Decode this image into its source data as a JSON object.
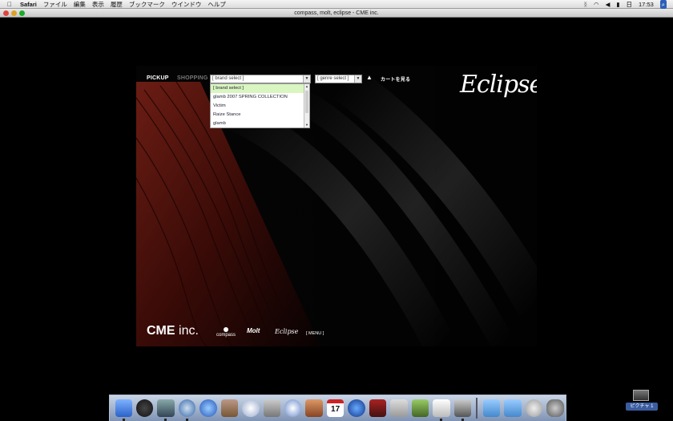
{
  "menubar": {
    "app": "Safari",
    "items": [
      "ファイル",
      "編集",
      "表示",
      "履歴",
      "ブックマーク",
      "ウインドウ",
      "ヘルプ"
    ],
    "status": {
      "input": "日",
      "clock": "17:53"
    }
  },
  "window": {
    "title": "compass, molt, eclipse - CME inc."
  },
  "site": {
    "nav_pickup": "PICKUP",
    "nav_shopping": "SHOPPING",
    "brand_select": "[ brand select ]",
    "genre_select": "[ genre select ]",
    "cart": "カートを見る",
    "brand_options": [
      "[ brand select ]",
      "glamb 2007 SPRING COLLECTION",
      "Victim",
      "Raize Stance",
      "glamb"
    ],
    "logo": "Eclipse",
    "company": "CME",
    "company_suffix": "inc.",
    "footer_compass": "compass",
    "footer_molt": "Molt",
    "footer_eclipse": "Eclipse",
    "footer_menu": "[ MENU ]"
  },
  "dock": {
    "apps": [
      "finder",
      "dashboard",
      "preview",
      "safari",
      "ichat",
      "address-book",
      "itunes",
      "iphoto",
      "imovie",
      "garageband",
      "ical",
      "quicktime",
      "dvd-player",
      "system-preferences",
      "script-editor",
      "textedit",
      "terminal"
    ],
    "ical_date": "17"
  },
  "desktop": {
    "volume_label": "ピクチャ 1"
  }
}
